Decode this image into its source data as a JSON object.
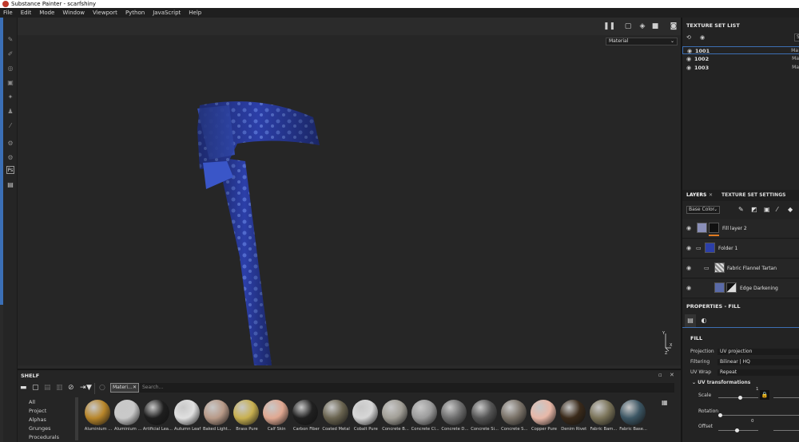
{
  "window": {
    "title": "Substance Painter - scarfshiny"
  },
  "menu": [
    "File",
    "Edit",
    "Mode",
    "Window",
    "Viewport",
    "Python",
    "JavaScript",
    "Help"
  ],
  "viewport": {
    "material_mode": "Material",
    "axis_labels": [
      "Y",
      "X",
      "Z"
    ]
  },
  "texture_set_list": {
    "title": "TEXTURE SET LIST",
    "filter_label": "S",
    "sets": [
      {
        "name": "1001",
        "material": "Ma",
        "selected": true
      },
      {
        "name": "1002",
        "material": "Ma",
        "selected": false
      },
      {
        "name": "1003",
        "material": "Ma",
        "selected": false
      }
    ]
  },
  "layers_panel": {
    "tab_layers": "LAYERS",
    "tab_texture_set_settings": "TEXTURE SET SETTINGS",
    "channel": "Base Color",
    "layers": [
      {
        "name": "Fill layer 2"
      },
      {
        "name": "Folder 1"
      },
      {
        "name": "Fabric Flannel Tartan"
      },
      {
        "name": "Edge Darkening"
      }
    ]
  },
  "properties": {
    "title": "PROPERTIES - FILL",
    "section": "FILL",
    "projection_label": "Projection",
    "projection_value": "UV projection",
    "filtering_label": "Filtering",
    "filtering_value": "Bilinear | HQ",
    "uvwrap_label": "UV Wrap",
    "uvwrap_value": "Repeat",
    "uv_transform_title": "UV transformations",
    "scale_label": "Scale",
    "scale_value": "1",
    "rotation_label": "Rotation",
    "offset_label": "Offset",
    "offset_value": "0"
  },
  "shelf": {
    "title": "SHELF",
    "filter_tag": "Materi...",
    "search_placeholder": "Search...",
    "categories": [
      "All",
      "Project",
      "Alphas",
      "Grunges",
      "Procedurals"
    ],
    "materials": [
      {
        "label": "Aluminium ...",
        "color": "#b8862a"
      },
      {
        "label": "Aluminium ...",
        "color": "#c9c9c9"
      },
      {
        "label": "Artificial Lea...",
        "color": "#1e1e1e"
      },
      {
        "label": "Autumn Leaf",
        "color": "#e0e0e0"
      },
      {
        "label": "Baked Light...",
        "color": "#b89a88"
      },
      {
        "label": "Brass Pure",
        "color": "#c8b050"
      },
      {
        "label": "Calf Skin",
        "color": "#e0a891"
      },
      {
        "label": "Carbon Fiber",
        "color": "#202020"
      },
      {
        "label": "Coated Metal",
        "color": "#6a6450"
      },
      {
        "label": "Cobalt Pure",
        "color": "#d7d7d7"
      },
      {
        "label": "Concrete B...",
        "color": "#a29f97"
      },
      {
        "label": "Concrete Cl...",
        "color": "#9c9c9c"
      },
      {
        "label": "Concrete D...",
        "color": "#6e6e6e"
      },
      {
        "label": "Concrete Si...",
        "color": "#555555"
      },
      {
        "label": "Concrete S...",
        "color": "#7a7268"
      },
      {
        "label": "Copper Pure",
        "color": "#e8b8a8"
      },
      {
        "label": "Denim Rivet",
        "color": "#3a2a1a"
      },
      {
        "label": "Fabric Bam...",
        "color": "#7a7358"
      },
      {
        "label": "Fabric Base...",
        "color": "#3c5664"
      }
    ]
  }
}
